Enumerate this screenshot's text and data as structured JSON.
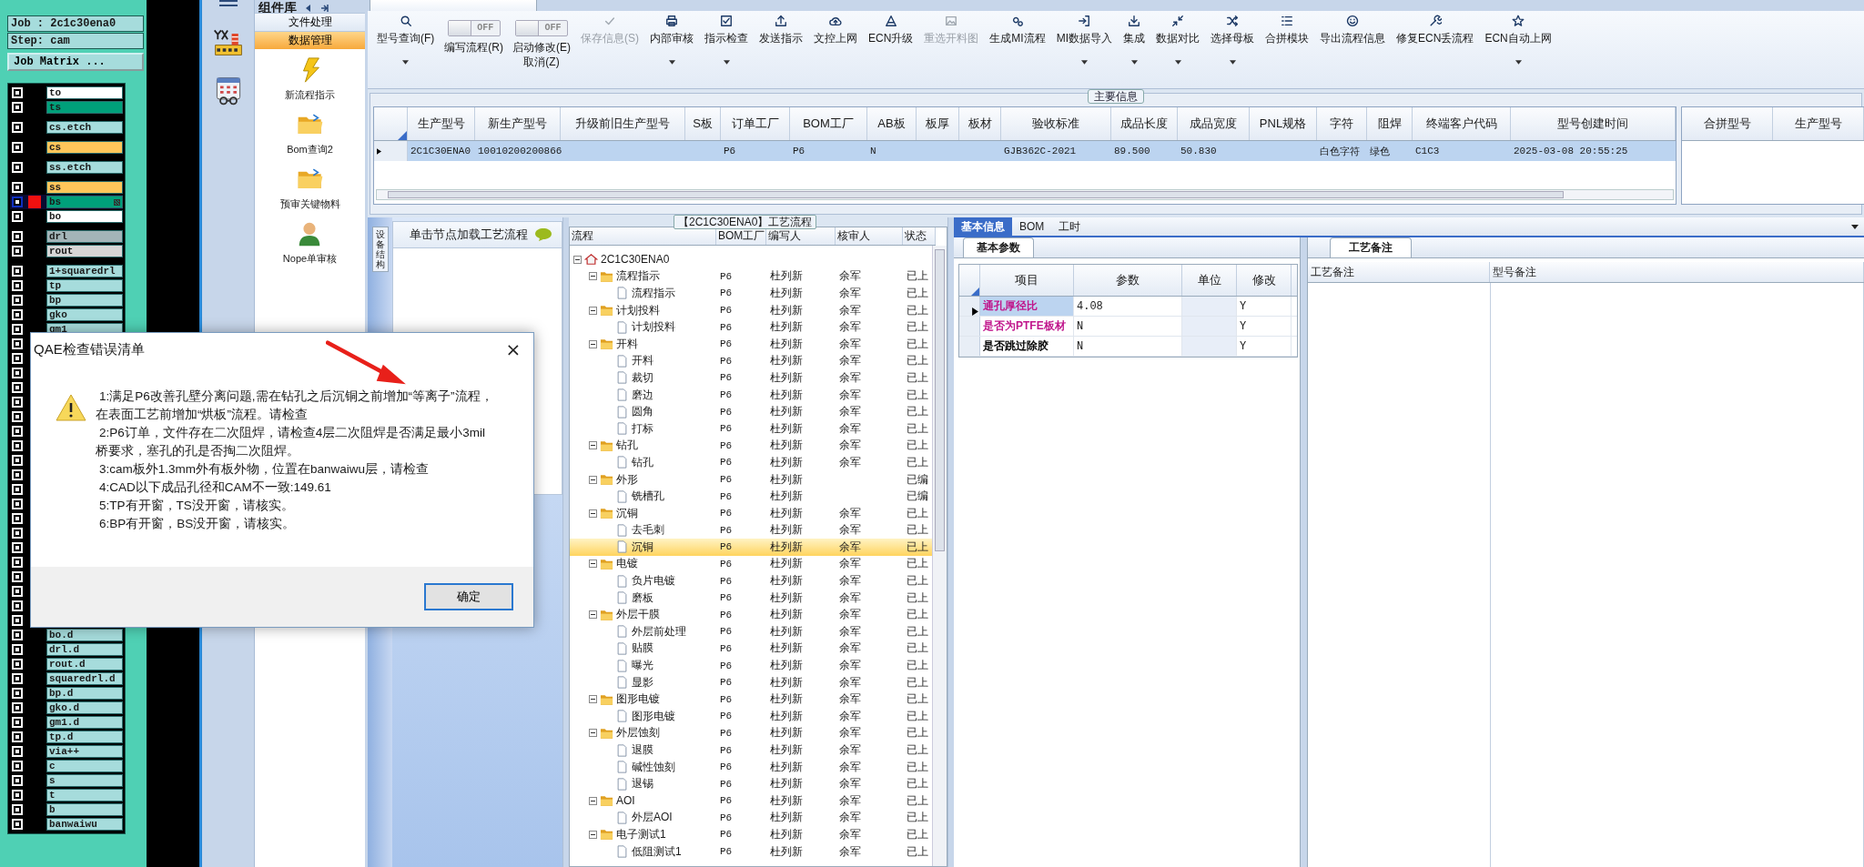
{
  "job_panel": {
    "job": "Job : 2c1c30ena0",
    "step": "Step: cam",
    "matrix_button": "Job Matrix ...",
    "layer_groups": [
      {
        "layers": [
          {
            "name": "to",
            "color": "#ffffff",
            "checked": true,
            "selected": false
          },
          {
            "name": "ts",
            "color": "#00a07a",
            "checked": true,
            "selected": false
          }
        ]
      },
      {
        "layers": [
          {
            "name": "cs.etch",
            "color": "#a6dcdc",
            "checked": true,
            "selected": false
          }
        ]
      },
      {
        "layers": [
          {
            "name": "cs",
            "color": "#ffc65a",
            "checked": true,
            "selected": false
          }
        ]
      },
      {
        "layers": [
          {
            "name": "ss.etch",
            "color": "#a6dcdc",
            "checked": true,
            "selected": false
          }
        ]
      },
      {
        "layers": [
          {
            "name": "ss",
            "color": "#ffc65a",
            "checked": true,
            "selected": false
          },
          {
            "name": "bs",
            "color": "#00a07a",
            "checked": true,
            "selected": true
          },
          {
            "name": "bo",
            "color": "#ffffff",
            "checked": true,
            "selected": false
          }
        ]
      },
      {
        "layers": [
          {
            "name": "drl",
            "color": "#a3b4b8",
            "checked": true,
            "selected": false
          },
          {
            "name": "rout",
            "color": "#d6d6d6",
            "checked": true,
            "selected": false
          }
        ]
      },
      {
        "layers": [
          {
            "name": "1+squaredrl",
            "color": "#a6dcdc",
            "checked": true,
            "selected": false
          },
          {
            "name": "tp",
            "color": "#a6dcdc",
            "checked": true,
            "selected": false
          },
          {
            "name": "bp",
            "color": "#a6dcdc",
            "checked": true,
            "selected": false
          },
          {
            "name": "gko",
            "color": "#a6dcdc",
            "checked": true,
            "selected": false
          },
          {
            "name": "gm1",
            "color": "#a6dcdc",
            "checked": true,
            "selected": false
          },
          {
            "checked": true,
            "selected": false
          },
          {
            "checked": true,
            "selected": false
          },
          {
            "checked": true,
            "selected": false
          },
          {
            "checked": true,
            "selected": false
          },
          {
            "checked": true,
            "selected": false
          },
          {
            "checked": true,
            "selected": false
          },
          {
            "checked": true,
            "selected": false
          },
          {
            "checked": true,
            "selected": false
          },
          {
            "checked": true,
            "selected": false
          },
          {
            "checked": true,
            "selected": false
          },
          {
            "checked": true,
            "selected": false
          },
          {
            "checked": true,
            "selected": false
          },
          {
            "checked": true,
            "selected": false
          },
          {
            "checked": true,
            "selected": false
          },
          {
            "checked": true,
            "selected": false
          },
          {
            "checked": true,
            "selected": false
          },
          {
            "checked": true,
            "selected": false
          },
          {
            "checked": true,
            "selected": false
          },
          {
            "checked": true,
            "selected": false
          },
          {
            "checked": true,
            "selected": false
          },
          {
            "name": "bo.d",
            "color": "#a6dcdc",
            "checked": true,
            "selected": false
          },
          {
            "name": "drl.d",
            "color": "#a6dcdc",
            "checked": true,
            "selected": false
          },
          {
            "name": "rout.d",
            "color": "#a6dcdc",
            "checked": true,
            "selected": false
          },
          {
            "name": "squaredrl.d",
            "color": "#a6dcdc",
            "checked": true,
            "selected": false
          },
          {
            "name": "bp.d",
            "color": "#a6dcdc",
            "checked": true,
            "selected": false
          },
          {
            "name": "gko.d",
            "color": "#a6dcdc",
            "checked": true,
            "selected": false
          },
          {
            "name": "gm1.d",
            "color": "#a6dcdc",
            "checked": true,
            "selected": false
          },
          {
            "name": "tp.d",
            "color": "#a6dcdc",
            "checked": true,
            "selected": false
          },
          {
            "name": "via++",
            "color": "#a6dcdc",
            "checked": true,
            "selected": false
          },
          {
            "name": "c",
            "color": "#a6dcdc",
            "checked": true,
            "selected": false
          },
          {
            "name": "s",
            "color": "#a6dcdc",
            "checked": true,
            "selected": false
          },
          {
            "name": "t",
            "color": "#a6dcdc",
            "checked": true,
            "selected": false
          },
          {
            "name": "b",
            "color": "#a6dcdc",
            "checked": true,
            "selected": false
          },
          {
            "name": "banwaiwu",
            "color": "#a6dcdc",
            "checked": true,
            "selected": false
          }
        ]
      }
    ]
  },
  "component_panel": {
    "title": "组件库",
    "categories": [
      {
        "label": "文件处理",
        "selected": false
      },
      {
        "label": "数据管理",
        "selected": true
      }
    ],
    "items": [
      {
        "label": "新流程指示"
      },
      {
        "label": "Bom查询2"
      },
      {
        "label": "预审关键物料"
      },
      {
        "label": "Nope单审核"
      }
    ]
  },
  "toolbar": [
    {
      "kind": "button",
      "label": "型号查询(F)",
      "disabled": false,
      "dropdown": true
    },
    {
      "kind": "toggle",
      "label": "编写流程(R)",
      "state_text": "OFF",
      "on": false
    },
    {
      "kind": "toggle",
      "label": "启动修改(E)",
      "second_label": "取消(Z)",
      "state_text": "OFF",
      "on": false
    },
    {
      "kind": "button",
      "label": "保存信息(S)",
      "disabled": true,
      "dropdown": false
    },
    {
      "kind": "button",
      "label": "内部审核",
      "disabled": false,
      "dropdown": true
    },
    {
      "kind": "button",
      "label": "指示检查",
      "disabled": false,
      "dropdown": true
    },
    {
      "kind": "button",
      "label": "发送指示",
      "disabled": false,
      "dropdown": false
    },
    {
      "kind": "button",
      "label": "文控上网",
      "disabled": false,
      "dropdown": false
    },
    {
      "kind": "button",
      "label": "ECN升级",
      "disabled": false,
      "dropdown": false
    },
    {
      "kind": "button",
      "label": "重选开料图",
      "disabled": true,
      "dropdown": false
    },
    {
      "kind": "button",
      "label": "生成MI流程",
      "disabled": false,
      "dropdown": false
    },
    {
      "kind": "button",
      "label": "MI数据导入",
      "disabled": false,
      "dropdown": true
    },
    {
      "kind": "button",
      "label": "集成",
      "disabled": false,
      "dropdown": true
    },
    {
      "kind": "button",
      "label": "数据对比",
      "disabled": false,
      "dropdown": true
    },
    {
      "kind": "button",
      "label": "选择母板",
      "disabled": false,
      "dropdown": true
    },
    {
      "kind": "button",
      "label": "合拼模块",
      "disabled": false,
      "dropdown": false
    },
    {
      "kind": "button",
      "label": "导出流程信息",
      "disabled": false,
      "dropdown": false
    },
    {
      "kind": "button",
      "label": "修复ECN丢流程",
      "disabled": false,
      "dropdown": false
    },
    {
      "kind": "button",
      "label": "ECN自动上网",
      "disabled": false,
      "dropdown": true
    }
  ],
  "main_info": {
    "title": "主要信息",
    "columns": [
      "生产型号",
      "新生产型号",
      "升级前旧生产型号",
      "S板",
      "订单工厂",
      "BOM工厂",
      "AB板",
      "板厚",
      "板材",
      "验收标准",
      "成品长度",
      "成品宽度",
      "PNL规格",
      "字符",
      "阻焊",
      "终端客户代码",
      "型号创建时间"
    ],
    "rows": [
      {
        "selected": true,
        "cells": [
          "2C1C30ENA0",
          "10010200200866",
          null,
          null,
          "P6",
          "P6",
          "N",
          null,
          null,
          "GJB362C-2021",
          "89.500",
          "50.830",
          null,
          "白色字符",
          "绿色",
          "C1C3",
          "2025-03-08 20:55:25"
        ]
      }
    ],
    "merge_columns": [
      "合拼型号",
      "生产型号"
    ]
  },
  "side_pane": {
    "vertical_tab": "设备结构",
    "hint": "单击节点加载工艺流程"
  },
  "process_tree": {
    "title": "【2C1C30ENA0】工艺流程",
    "columns": [
      "流程",
      "BOM工厂",
      "编写人",
      "核审人",
      "状态"
    ],
    "nodes": [
      {
        "name": "2C1C30ENA0",
        "expanded": true,
        "selected": false,
        "children": [
          {
            "name": "流程指示",
            "bom": "P6",
            "writer": "杜列新",
            "reviewer": "余军",
            "status": "已上",
            "expanded": true,
            "selected": false,
            "children": [
              {
                "name": "流程指示",
                "bom": "P6",
                "writer": "杜列新",
                "reviewer": "余军",
                "status": "已上",
                "selected": false
              }
            ]
          },
          {
            "name": "计划投料",
            "bom": "P6",
            "writer": "杜列新",
            "reviewer": "余军",
            "status": "已上",
            "expanded": true,
            "selected": false,
            "children": [
              {
                "name": "计划投料",
                "bom": "P6",
                "writer": "杜列新",
                "reviewer": "余军",
                "status": "已上",
                "selected": false
              }
            ]
          },
          {
            "name": "开料",
            "bom": "P6",
            "writer": "杜列新",
            "reviewer": "余军",
            "status": "已上",
            "expanded": true,
            "selected": false,
            "children": [
              {
                "name": "开料",
                "bom": "P6",
                "writer": "杜列新",
                "reviewer": "余军",
                "status": "已上",
                "selected": false
              },
              {
                "name": "裁切",
                "bom": "P6",
                "writer": "杜列新",
                "reviewer": "余军",
                "status": "已上",
                "selected": false
              },
              {
                "name": "磨边",
                "bom": "P6",
                "writer": "杜列新",
                "reviewer": "余军",
                "status": "已上",
                "selected": false
              },
              {
                "name": "圆角",
                "bom": "P6",
                "writer": "杜列新",
                "reviewer": "余军",
                "status": "已上",
                "selected": false
              },
              {
                "name": "打标",
                "bom": "P6",
                "writer": "杜列新",
                "reviewer": "余军",
                "status": "已上",
                "selected": false
              }
            ]
          },
          {
            "name": "钻孔",
            "bom": "P6",
            "writer": "杜列新",
            "reviewer": "余军",
            "status": "已上",
            "expanded": true,
            "selected": false,
            "children": [
              {
                "name": "钻孔",
                "bom": "P6",
                "writer": "杜列新",
                "reviewer": "余军",
                "status": "已上",
                "selected": false
              }
            ]
          },
          {
            "name": "外形",
            "bom": "P6",
            "writer": "杜列新",
            "status": "已编",
            "expanded": true,
            "selected": false,
            "children": [
              {
                "name": "铣槽孔",
                "bom": "P6",
                "writer": "杜列新",
                "status": "已编",
                "selected": false
              }
            ]
          },
          {
            "name": "沉铜",
            "bom": "P6",
            "writer": "杜列新",
            "reviewer": "余军",
            "status": "已上",
            "expanded": true,
            "selected": false,
            "children": [
              {
                "name": "去毛刺",
                "bom": "P6",
                "writer": "杜列新",
                "reviewer": "余军",
                "status": "已上",
                "selected": false
              },
              {
                "name": "沉铜",
                "bom": "P6",
                "writer": "杜列新",
                "reviewer": "余军",
                "status": "已上",
                "selected": true
              }
            ]
          },
          {
            "name": "电镀",
            "bom": "P6",
            "writer": "杜列新",
            "reviewer": "余军",
            "status": "已上",
            "expanded": true,
            "selected": false,
            "children": [
              {
                "name": "负片电镀",
                "bom": "P6",
                "writer": "杜列新",
                "reviewer": "余军",
                "status": "已上",
                "selected": false
              },
              {
                "name": "磨板",
                "bom": "P6",
                "writer": "杜列新",
                "reviewer": "余军",
                "status": "已上",
                "selected": false
              }
            ]
          },
          {
            "name": "外层干膜",
            "bom": "P6",
            "writer": "杜列新",
            "reviewer": "余军",
            "status": "已上",
            "expanded": true,
            "selected": false,
            "children": [
              {
                "name": "外层前处理",
                "bom": "P6",
                "writer": "杜列新",
                "reviewer": "余军",
                "status": "已上",
                "selected": false
              },
              {
                "name": "贴膜",
                "bom": "P6",
                "writer": "杜列新",
                "reviewer": "余军",
                "status": "已上",
                "selected": false
              },
              {
                "name": "曝光",
                "bom": "P6",
                "writer": "杜列新",
                "reviewer": "余军",
                "status": "已上",
                "selected": false
              },
              {
                "name": "显影",
                "bom": "P6",
                "writer": "杜列新",
                "reviewer": "余军",
                "status": "已上",
                "selected": false
              }
            ]
          },
          {
            "name": "图形电镀",
            "bom": "P6",
            "writer": "杜列新",
            "reviewer": "余军",
            "status": "已上",
            "expanded": true,
            "selected": false,
            "children": [
              {
                "name": "图形电镀",
                "bom": "P6",
                "writer": "杜列新",
                "reviewer": "余军",
                "status": "已上",
                "selected": false
              }
            ]
          },
          {
            "name": "外层蚀刻",
            "bom": "P6",
            "writer": "杜列新",
            "reviewer": "余军",
            "status": "已上",
            "expanded": true,
            "selected": false,
            "children": [
              {
                "name": "退膜",
                "bom": "P6",
                "writer": "杜列新",
                "reviewer": "余军",
                "status": "已上",
                "selected": false
              },
              {
                "name": "碱性蚀刻",
                "bom": "P6",
                "writer": "杜列新",
                "reviewer": "余军",
                "status": "已上",
                "selected": false
              },
              {
                "name": "退锡",
                "bom": "P6",
                "writer": "杜列新",
                "reviewer": "余军",
                "status": "已上",
                "selected": false
              }
            ]
          },
          {
            "name": "AOI",
            "bom": "P6",
            "writer": "杜列新",
            "reviewer": "余军",
            "status": "已上",
            "expanded": true,
            "selected": false,
            "children": [
              {
                "name": "外层AOI",
                "bom": "P6",
                "writer": "杜列新",
                "reviewer": "余军",
                "status": "已上",
                "selected": false
              }
            ]
          },
          {
            "name": "电子测试1",
            "bom": "P6",
            "writer": "杜列新",
            "reviewer": "余军",
            "status": "已上",
            "expanded": true,
            "selected": false,
            "children": [
              {
                "name": "低阻测试1",
                "bom": "P6",
                "writer": "杜列新",
                "reviewer": "余军",
                "status": "已上",
                "selected": false
              }
            ]
          }
        ]
      }
    ]
  },
  "detail_tabs": [
    {
      "label": "基本信息",
      "selected": true
    },
    {
      "label": "BOM",
      "selected": false
    },
    {
      "label": "工时",
      "selected": false
    }
  ],
  "basic_params": {
    "tab": "基本参数",
    "columns": [
      "项目",
      "参数",
      "单位",
      "修改"
    ],
    "rows": [
      {
        "item": "通孔厚径比",
        "color": "#c0168c",
        "value": "4.08",
        "modified": "Y",
        "selected": true
      },
      {
        "item": "是否为PTFE板材",
        "color": "#c0168c",
        "value": "N",
        "modified": "Y",
        "selected": false
      },
      {
        "item": "是否跳过除胶",
        "color": "#000000",
        "value": "N",
        "modified": "Y",
        "selected": false
      }
    ]
  },
  "process_notes": {
    "tab": "工艺备注",
    "columns": [
      "工艺备注",
      "型号备注"
    ]
  },
  "dialog": {
    "title": "QAE检查错误清单",
    "close": "×",
    "messages": [
      "1:满足P6改善孔壁分离问题,需在钻孔之后沉铜之前增加“等离子”流程，在表面工艺前增加“烘板”流程。请检查",
      "2:P6订单，文件存在二次阻焊，请检查4层二次阻焊是否满足最小3mil桥要求，塞孔的孔是否掏二次阻焊。",
      "3:cam板外1.3mm外有板外物，位置在banwaiwu层，请检查",
      "4:CAD以下成品孔径和CAM不一致:149.61",
      "5:TP有开窗，TS没开窗，请核实。",
      "6:BP有开窗，BS没开窗，请核实。"
    ],
    "ok_button": "确定"
  }
}
